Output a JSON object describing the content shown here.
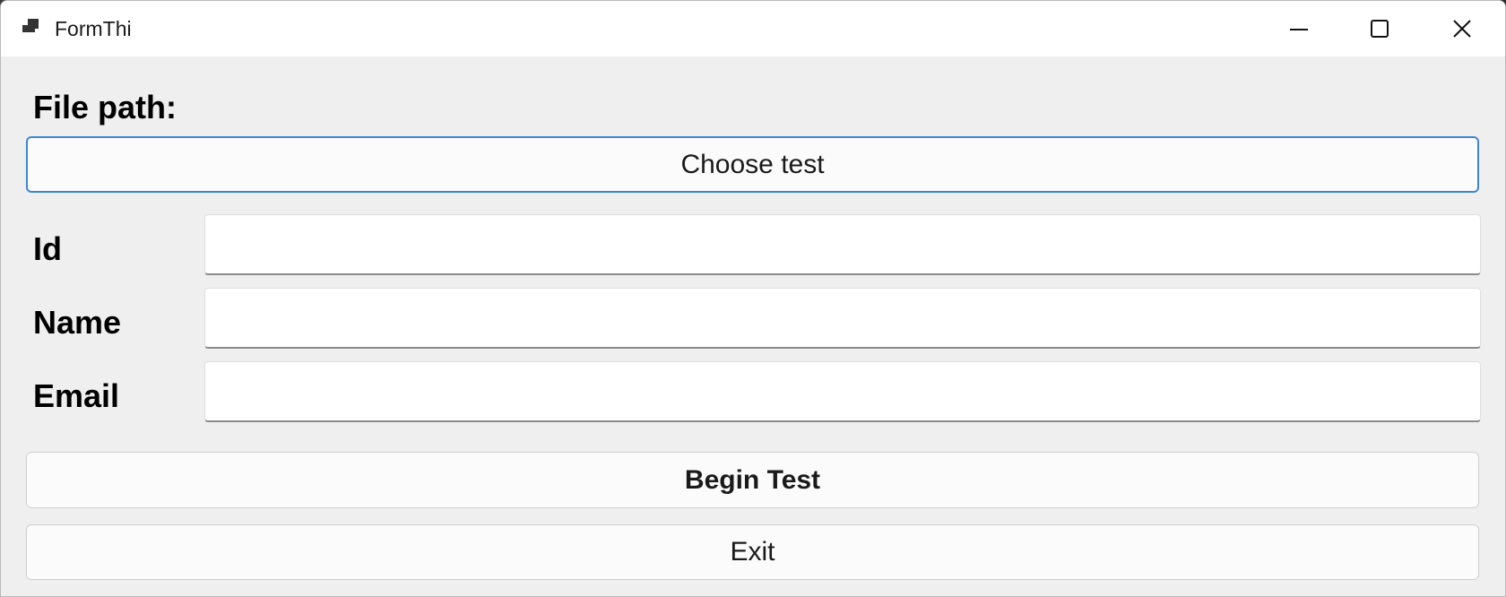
{
  "window": {
    "title": "FormThi",
    "icon": "app-window-icon",
    "controls": [
      "minimize-icon",
      "maximize-icon",
      "close-icon"
    ]
  },
  "form": {
    "file_path_label": "File path:",
    "choose_test_button": "Choose test",
    "id_label": "Id",
    "id_value": "",
    "name_label": "Name",
    "name_value": "",
    "email_label": "Email",
    "email_value": "",
    "begin_test_button": "Begin Test",
    "exit_button": "Exit"
  },
  "colors": {
    "accent_border": "#3b86d4",
    "window_bg": "#efefef",
    "titlebar_bg": "#ffffff"
  }
}
